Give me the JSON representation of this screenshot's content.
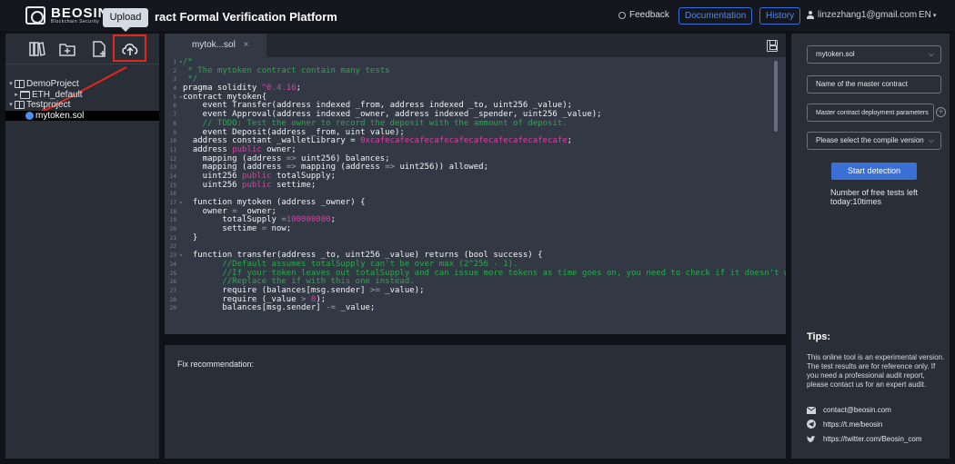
{
  "header": {
    "logo_name": "BEOSIN",
    "logo_sub": "Blockchain Security",
    "title_partial": "ract Formal Verification Platform",
    "upload_tooltip": "Upload",
    "feedback": "Feedback",
    "documentation": "Documentation",
    "history": "History",
    "user_email": "linzezhang1@gmail.com",
    "language": "EN"
  },
  "file_tree": [
    {
      "label": "DemoProject",
      "indent": 0,
      "caret": "▾",
      "icon": "book-icon",
      "selected": false
    },
    {
      "label": "ETH_default",
      "indent": 1,
      "caret": "▸",
      "icon": "folder-icon",
      "selected": false
    },
    {
      "label": "Testproject",
      "indent": 0,
      "caret": "▾",
      "icon": "book-icon",
      "selected": false
    },
    {
      "label": "mytoken.sol",
      "indent": 2,
      "caret": "",
      "icon": "solidity-file-icon",
      "selected": true
    }
  ],
  "editor": {
    "tab_label": "mytok...sol",
    "tab_close": "×"
  },
  "code_lines": [
    {
      "n": "1",
      "f": "▾",
      "segs": [
        [
          "cm",
          "/*"
        ]
      ]
    },
    {
      "n": "2",
      "f": "",
      "segs": [
        [
          "cm",
          " * The mytoken contract contain many tests"
        ]
      ]
    },
    {
      "n": "3",
      "f": "",
      "segs": [
        [
          "cm",
          " */"
        ]
      ]
    },
    {
      "n": "4",
      "f": "",
      "segs": [
        [
          "t",
          "pragma solidity "
        ],
        [
          "nm",
          "^0.4.16"
        ],
        [
          "t",
          ";"
        ]
      ]
    },
    {
      "n": "5",
      "f": "▾",
      "segs": [
        [
          "t",
          "contract mytoken{"
        ]
      ]
    },
    {
      "n": "6",
      "f": "",
      "segs": [
        [
          "t",
          "    event Transfer(address indexed _from, address indexed _to, uint256 _value);"
        ]
      ]
    },
    {
      "n": "7",
      "f": "",
      "segs": [
        [
          "t",
          "    event Approval(address indexed _owner, address indexed _spender, uint256 _value);"
        ]
      ]
    },
    {
      "n": "8",
      "f": "",
      "segs": [
        [
          "cm",
          "    // TODO: Test the owner to record the deposit with the ammount of deposit."
        ]
      ]
    },
    {
      "n": "9",
      "f": "",
      "segs": [
        [
          "t",
          "    event Deposit(address _from, uint value);"
        ]
      ]
    },
    {
      "n": "10",
      "f": "",
      "segs": [
        [
          "t",
          "  address constant _walletLibrary = "
        ],
        [
          "str",
          "0xcafecafecafecafecafecafecafecafecafecafe"
        ],
        [
          "t",
          ";"
        ]
      ]
    },
    {
      "n": "11",
      "f": "",
      "segs": [
        [
          "t",
          "  address "
        ],
        [
          "kw",
          "public"
        ],
        [
          "t",
          " owner;"
        ]
      ]
    },
    {
      "n": "12",
      "f": "",
      "segs": [
        [
          "t",
          "    mapping (address "
        ],
        [
          "op",
          "=>"
        ],
        [
          "t",
          " uint256) balances;"
        ]
      ]
    },
    {
      "n": "13",
      "f": "",
      "segs": [
        [
          "t",
          "    mapping (address "
        ],
        [
          "op",
          "=>"
        ],
        [
          "t",
          " mapping (address "
        ],
        [
          "op",
          "=>"
        ],
        [
          "t",
          " uint256)) allowed;"
        ]
      ]
    },
    {
      "n": "14",
      "f": "",
      "segs": [
        [
          "t",
          "    uint256 "
        ],
        [
          "kw",
          "public"
        ],
        [
          "t",
          " totalSupply;"
        ]
      ]
    },
    {
      "n": "15",
      "f": "",
      "segs": [
        [
          "t",
          "    uint256 "
        ],
        [
          "kw",
          "public"
        ],
        [
          "t",
          " settime;"
        ]
      ]
    },
    {
      "n": "16",
      "f": "",
      "segs": [
        [
          "t",
          ""
        ]
      ]
    },
    {
      "n": "17",
      "f": "▾",
      "segs": [
        [
          "t",
          "  function mytoken (address _owner) {"
        ]
      ]
    },
    {
      "n": "18",
      "f": "",
      "segs": [
        [
          "t",
          "    owner "
        ],
        [
          "op",
          "="
        ],
        [
          "t",
          " _owner;"
        ]
      ]
    },
    {
      "n": "19",
      "f": "",
      "segs": [
        [
          "t",
          "        totalSupply "
        ],
        [
          "op",
          "="
        ],
        [
          "nm",
          "100000000"
        ],
        [
          "t",
          ";"
        ]
      ]
    },
    {
      "n": "20",
      "f": "",
      "segs": [
        [
          "t",
          "        settime "
        ],
        [
          "op",
          "="
        ],
        [
          "t",
          " now;"
        ]
      ]
    },
    {
      "n": "21",
      "f": "",
      "segs": [
        [
          "t",
          "  }"
        ]
      ]
    },
    {
      "n": "22",
      "f": "",
      "segs": [
        [
          "t",
          ""
        ]
      ]
    },
    {
      "n": "23",
      "f": "▾",
      "segs": [
        [
          "t",
          "  function transfer(address _to, uint256 _value) returns (bool success) {"
        ]
      ]
    },
    {
      "n": "24",
      "f": "",
      "segs": [
        [
          "cm",
          "        //Default assumes totalSupply can't be over max (2^256 - 1)."
        ]
      ]
    },
    {
      "n": "25",
      "f": "",
      "segs": [
        [
          "cm",
          "        //If your token leaves out totalSupply and can issue more tokens as time goes on, you need to check if it doesn't wrap."
        ]
      ]
    },
    {
      "n": "26",
      "f": "",
      "segs": [
        [
          "cm",
          "        //Replace the if with this one instead."
        ]
      ]
    },
    {
      "n": "27",
      "f": "",
      "segs": [
        [
          "t",
          "        require (balances[msg.sender] "
        ],
        [
          "op",
          ">="
        ],
        [
          "t",
          " _value);"
        ]
      ]
    },
    {
      "n": "28",
      "f": "",
      "segs": [
        [
          "t",
          "        require (_value "
        ],
        [
          "op",
          ">"
        ],
        [
          "t",
          " "
        ],
        [
          "nm",
          "0"
        ],
        [
          "t",
          ");"
        ]
      ]
    },
    {
      "n": "29",
      "f": "",
      "segs": [
        [
          "t",
          "        balances[msg.sender] "
        ],
        [
          "op",
          "-="
        ],
        [
          "t",
          " _value;"
        ]
      ]
    }
  ],
  "fix_panel": {
    "label": "Fix recommendation:"
  },
  "right": {
    "contract_select": "mytoken.sol",
    "master_contract_placeholder": "Name of the master contract",
    "deployment_params": "Master contract deployment parameters",
    "compile_version_placeholder": "Please select the compile version",
    "start_button": "Start detection",
    "free_tests_label": "Number of free tests left",
    "free_tests_value": "today:10times",
    "tips_title": "Tips:",
    "tips_body": "This online tool is an experimental version. The test results are for reference only. If you need a professional audit report, please contact us for an expert audit.",
    "email": "contact@beosin.com",
    "telegram": "https://t.me/beosin",
    "twitter": "https://twitter.com/Beosin_com"
  },
  "colors": {
    "accent": "#3a6fd6",
    "highlight_red": "#e0281f",
    "comment_green": "#2aa84a",
    "keyword_pink": "#d6409f"
  }
}
